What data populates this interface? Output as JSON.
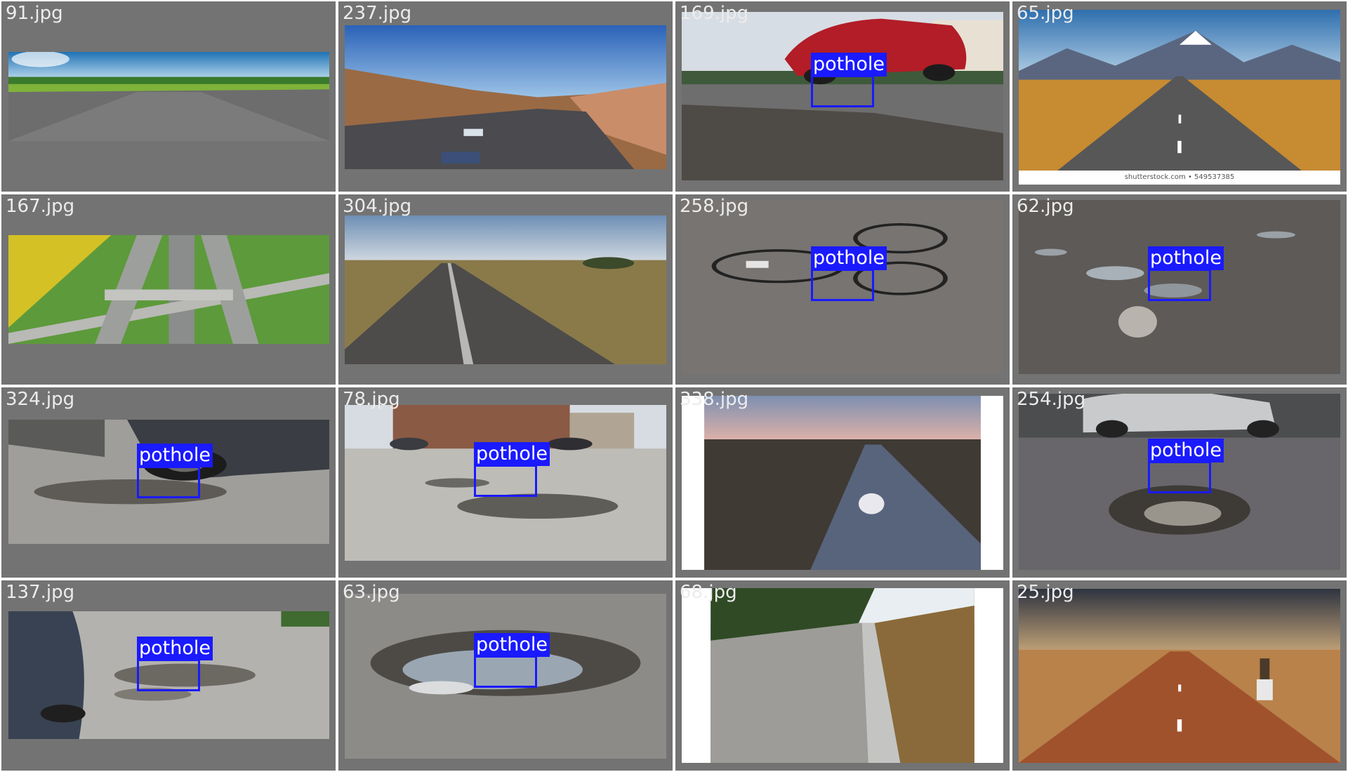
{
  "grid": {
    "tiles": [
      {
        "filename": "91.jpg",
        "detection": ""
      },
      {
        "filename": "237.jpg",
        "detection": ""
      },
      {
        "filename": "169.jpg",
        "detection": "pothole"
      },
      {
        "filename": "65.jpg",
        "detection": "",
        "watermark": "shutterstock.com • 549537385"
      },
      {
        "filename": "167.jpg",
        "detection": ""
      },
      {
        "filename": "304.jpg",
        "detection": ""
      },
      {
        "filename": "258.jpg",
        "detection": "pothole"
      },
      {
        "filename": "62.jpg",
        "detection": "pothole"
      },
      {
        "filename": "324.jpg",
        "detection": "pothole"
      },
      {
        "filename": "78.jpg",
        "detection": "pothole"
      },
      {
        "filename": "338.jpg",
        "detection": ""
      },
      {
        "filename": "254.jpg",
        "detection": "pothole"
      },
      {
        "filename": "137.jpg",
        "detection": "pothole"
      },
      {
        "filename": "63.jpg",
        "detection": "pothole"
      },
      {
        "filename": "68.jpg",
        "detection": ""
      },
      {
        "filename": "25.jpg",
        "detection": ""
      }
    ]
  },
  "colors": {
    "tile_background": "#737373",
    "detection_box": "#1a1aff",
    "label_text": "#ffffff"
  }
}
